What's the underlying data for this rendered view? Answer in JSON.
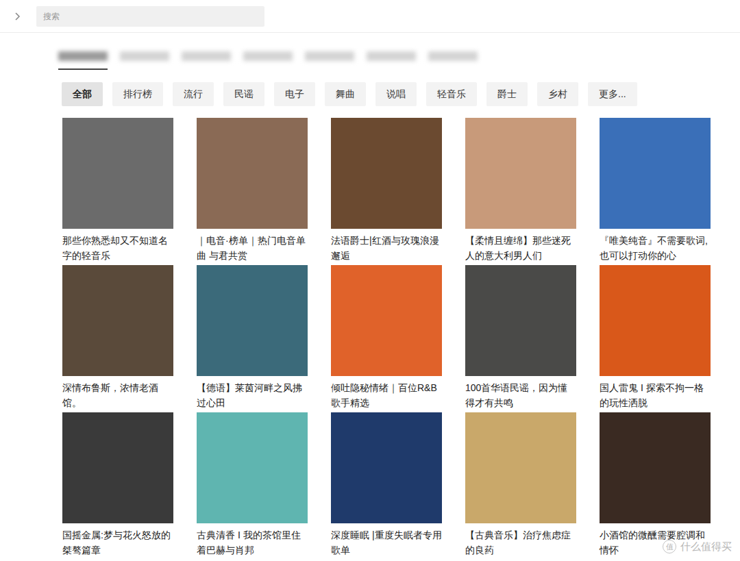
{
  "search": {
    "placeholder": "搜索"
  },
  "tabs": [
    {
      "selected": true
    },
    {
      "selected": false
    },
    {
      "selected": false
    },
    {
      "selected": false
    },
    {
      "selected": false
    },
    {
      "selected": false
    },
    {
      "selected": false
    }
  ],
  "categories": [
    {
      "label": "全部",
      "selected": true
    },
    {
      "label": "排行榜",
      "selected": false
    },
    {
      "label": "流行",
      "selected": false
    },
    {
      "label": "民谣",
      "selected": false
    },
    {
      "label": "电子",
      "selected": false
    },
    {
      "label": "舞曲",
      "selected": false
    },
    {
      "label": "说唱",
      "selected": false
    },
    {
      "label": "轻音乐",
      "selected": false
    },
    {
      "label": "爵士",
      "selected": false
    },
    {
      "label": "乡村",
      "selected": false
    },
    {
      "label": "更多...",
      "selected": false
    }
  ],
  "playlists": [
    {
      "title": "那些你熟悉却又不知道名字的轻音乐",
      "color": "#6b6b6b"
    },
    {
      "title": "｜电音·榜单｜热门电音单曲 与君共赏",
      "color": "#8a6a55"
    },
    {
      "title": "法语爵士|红酒与玫瑰浪漫邂逅",
      "color": "#6b4a30"
    },
    {
      "title": "【柔情且缠绵】那些迷死人的意大利男人们",
      "color": "#c89a7a"
    },
    {
      "title": "『唯美纯音』不需要歌词,也可以打动你的心",
      "color": "#3a6fb8"
    },
    {
      "title": "深情布鲁斯，浓情老酒馆。",
      "color": "#5a4a3a"
    },
    {
      "title": "【德语】莱茵河畔之风拂过心田",
      "color": "#3b6a7a"
    },
    {
      "title": "倾吐隐秘情绪｜百位R&B歌手精选",
      "color": "#e0622a"
    },
    {
      "title": "100首华语民谣，因为懂得才有共鸣",
      "color": "#4a4a48"
    },
    {
      "title": "国人雷鬼 I 探索不拘一格的玩性洒脱",
      "color": "#d9581a"
    },
    {
      "title": "国摇金属:梦与花火怒放的桀骜篇章",
      "color": "#3a3a3a"
    },
    {
      "title": "古典清香 I 我的茶馆里住着巴赫与肖邦",
      "color": "#5fb5b0"
    },
    {
      "title": "深度睡眠 |重度失眠者专用歌单",
      "color": "#1f3a6b"
    },
    {
      "title": "【古典音乐】治疗焦虑症的良药",
      "color": "#c9a86a"
    },
    {
      "title": "小酒馆的微醺需要腔调和情怀",
      "color": "#3a2a22"
    }
  ],
  "watermark": {
    "icon": "值",
    "text": "什么值得买"
  }
}
